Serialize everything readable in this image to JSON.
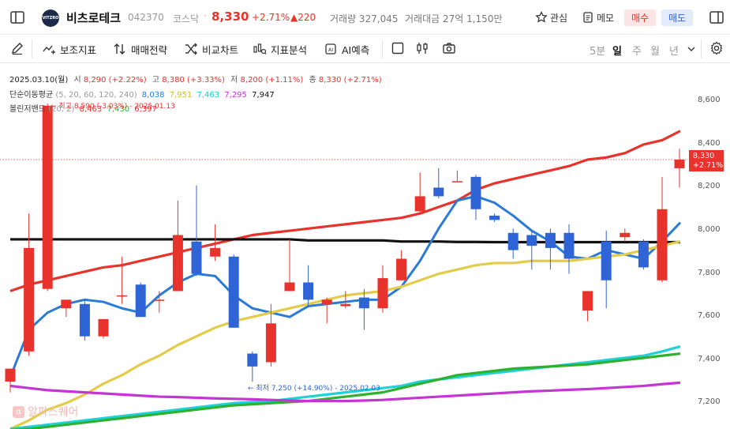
{
  "header": {
    "stock_name": "비츠로테크",
    "stock_code": "042370",
    "market": "코스닥",
    "separator": "·",
    "price": "8,330",
    "change_pct": "+2.71%",
    "change_abs": "▲220",
    "volume": "거래량 327,045",
    "amount": "거래대금 27억 1,150만",
    "logo_text": "VITZRO",
    "watch_label": "관심",
    "memo_label": "메모",
    "buy_label": "매수",
    "sell_label": "매도",
    "colors": {
      "up": "#e8322c",
      "down": "#2f64d6"
    }
  },
  "toolbar": {
    "items": [
      {
        "label": "보조지표",
        "icon": "indicator-icon"
      },
      {
        "label": "매매전략",
        "icon": "strategy-icon"
      },
      {
        "label": "비교차트",
        "icon": "compare-icon"
      },
      {
        "label": "지표분석",
        "icon": "analysis-icon"
      },
      {
        "label": "AI예측",
        "icon": "ai-icon"
      }
    ],
    "periods": [
      "5분",
      "일",
      "주",
      "월",
      "년"
    ],
    "active_period": "일"
  },
  "info": {
    "ohlc": {
      "date": "2025.03.10(월)",
      "open_label": "시",
      "open": "8,290 (+2.22%)",
      "high_label": "고",
      "high": "8,380 (+3.33%)",
      "low_label": "저",
      "low": "8,200 (+1.11%)",
      "close_label": "종",
      "close": "8,330 (+2.71%)"
    },
    "ma": {
      "label": "단순이동평균",
      "params": "(5, 20, 60, 120, 240)",
      "values": [
        "8,038",
        "7,951",
        "7,463",
        "7,295",
        "7,947"
      ],
      "colors": [
        "#2a7bd6",
        "#e3cc4a",
        "#1fd2d8",
        "#c435d4",
        "#111111"
      ]
    },
    "bb": {
      "label": "볼린저밴드",
      "params": "(20, 2)",
      "values": [
        "8,463",
        "7,430",
        "6,397"
      ],
      "colors": [
        "#e8322c",
        "#2fb02f",
        "#e8322c"
      ]
    }
  },
  "annotations": {
    "high": "← 최고 8,590 (-3.03%) - 2025.01.13",
    "low": "← 최저 7,250 (+14.90%) - 2025.02.03"
  },
  "current_price_tag": {
    "price": "8,330",
    "pct": "+2.71%"
  },
  "watermark": {
    "text": "알파스퀘어",
    "icon": "α"
  },
  "chart_data": {
    "type": "candlestick",
    "y_axis_ticks": [
      "8,600",
      "8,400",
      "8,200",
      "8,000",
      "7,800",
      "7,600",
      "7,400",
      "7,200"
    ],
    "y_range": [
      7080,
      8770
    ],
    "candles": [
      {
        "o": 7300,
        "h": 7360,
        "l": 7250,
        "c": 7360
      },
      {
        "o": 7440,
        "h": 8080,
        "l": 7420,
        "c": 7920
      },
      {
        "o": 7730,
        "h": 8590,
        "l": 7720,
        "c": 8580
      },
      {
        "o": 7640,
        "h": 7680,
        "l": 7600,
        "c": 7680
      },
      {
        "o": 7660,
        "h": 7680,
        "l": 7490,
        "c": 7510
      },
      {
        "o": 7510,
        "h": 7580,
        "l": 7500,
        "c": 7590
      },
      {
        "o": 7700,
        "h": 7880,
        "l": 7660,
        "c": 7700
      },
      {
        "o": 7750,
        "h": 7760,
        "l": 7600,
        "c": 7600
      },
      {
        "o": 7680,
        "h": 7720,
        "l": 7620,
        "c": 7680
      },
      {
        "o": 7720,
        "h": 8140,
        "l": 7720,
        "c": 7980
      },
      {
        "o": 7950,
        "h": 8210,
        "l": 7790,
        "c": 7800
      },
      {
        "o": 7880,
        "h": 8030,
        "l": 7860,
        "c": 7920
      },
      {
        "o": 7880,
        "h": 7890,
        "l": 7550,
        "c": 7550
      },
      {
        "o": 7430,
        "h": 7440,
        "l": 7300,
        "c": 7370
      },
      {
        "o": 7390,
        "h": 7660,
        "l": 7370,
        "c": 7570
      },
      {
        "o": 7720,
        "h": 7960,
        "l": 7720,
        "c": 7760
      },
      {
        "o": 7760,
        "h": 7840,
        "l": 7650,
        "c": 7680
      },
      {
        "o": 7660,
        "h": 7690,
        "l": 7570,
        "c": 7680
      },
      {
        "o": 7650,
        "h": 7720,
        "l": 7640,
        "c": 7660
      },
      {
        "o": 7690,
        "h": 7730,
        "l": 7540,
        "c": 7640
      },
      {
        "o": 7640,
        "h": 7840,
        "l": 7620,
        "c": 7780
      },
      {
        "o": 7770,
        "h": 7910,
        "l": 7770,
        "c": 7870
      },
      {
        "o": 8090,
        "h": 8270,
        "l": 8080,
        "c": 8160
      },
      {
        "o": 8200,
        "h": 8290,
        "l": 8150,
        "c": 8160
      },
      {
        "o": 8230,
        "h": 8280,
        "l": 8230,
        "c": 8230
      },
      {
        "o": 8250,
        "h": 8260,
        "l": 8050,
        "c": 8100
      },
      {
        "o": 8070,
        "h": 8080,
        "l": 8040,
        "c": 8050
      },
      {
        "o": 7990,
        "h": 8010,
        "l": 7870,
        "c": 7910
      },
      {
        "o": 7980,
        "h": 8000,
        "l": 7820,
        "c": 7930
      },
      {
        "o": 7990,
        "h": 8010,
        "l": 7820,
        "c": 7920
      },
      {
        "o": 7990,
        "h": 8030,
        "l": 7800,
        "c": 7870
      },
      {
        "o": 7630,
        "h": 7650,
        "l": 7580,
        "c": 7720
      },
      {
        "o": 7950,
        "h": 8000,
        "l": 7640,
        "c": 7770
      },
      {
        "o": 7970,
        "h": 8010,
        "l": 7950,
        "c": 7990
      },
      {
        "o": 7950,
        "h": 7960,
        "l": 7820,
        "c": 7830
      },
      {
        "o": 7770,
        "h": 8250,
        "l": 7760,
        "c": 8100
      },
      {
        "o": 8290,
        "h": 8380,
        "l": 8200,
        "c": 8330
      }
    ],
    "series": [
      {
        "name": "BB 상단",
        "color": "#e8322c",
        "values": [
          7720,
          7750,
          7770,
          7790,
          7810,
          7830,
          7840,
          7860,
          7880,
          7900,
          7920,
          7940,
          7960,
          7980,
          7990,
          8000,
          8010,
          8020,
          8030,
          8040,
          8050,
          8060,
          8080,
          8110,
          8140,
          8190,
          8220,
          8240,
          8260,
          8280,
          8300,
          8330,
          8340,
          8360,
          8400,
          8420,
          8463
        ]
      },
      {
        "name": "MA240",
        "color": "#111111",
        "values": [
          7960,
          7960,
          7960,
          7960,
          7960,
          7960,
          7960,
          7960,
          7960,
          7960,
          7960,
          7960,
          7960,
          7960,
          7960,
          7960,
          7955,
          7955,
          7955,
          7955,
          7955,
          7950,
          7950,
          7950,
          7948,
          7948,
          7947,
          7947,
          7947,
          7947,
          7947,
          7947,
          7947,
          7947,
          7947,
          7947,
          7947
        ]
      },
      {
        "name": "MA5",
        "color": "#2a7bd6",
        "values": [
          7320,
          7540,
          7620,
          7660,
          7680,
          7670,
          7640,
          7620,
          7700,
          7760,
          7800,
          7790,
          7700,
          7640,
          7620,
          7600,
          7650,
          7660,
          7670,
          7680,
          7680,
          7740,
          7860,
          8010,
          8140,
          8160,
          8130,
          8070,
          8000,
          7950,
          7880,
          7870,
          7910,
          7890,
          7870,
          7950,
          8038
        ]
      },
      {
        "name": "MA20",
        "color": "#e3cc4a",
        "values": [
          7080,
          7120,
          7170,
          7200,
          7240,
          7290,
          7330,
          7380,
          7420,
          7470,
          7510,
          7550,
          7580,
          7600,
          7620,
          7640,
          7660,
          7680,
          7700,
          7710,
          7720,
          7740,
          7770,
          7800,
          7820,
          7840,
          7850,
          7850,
          7860,
          7860,
          7860,
          7870,
          7880,
          7890,
          7910,
          7930,
          7951
        ]
      },
      {
        "name": "MA60",
        "color": "#1fd2d8",
        "values": [
          7080,
          7090,
          7100,
          7110,
          7120,
          7130,
          7140,
          7150,
          7160,
          7170,
          7180,
          7190,
          7200,
          7205,
          7210,
          7220,
          7230,
          7240,
          7250,
          7260,
          7270,
          7280,
          7300,
          7310,
          7320,
          7330,
          7340,
          7350,
          7360,
          7370,
          7380,
          7390,
          7400,
          7410,
          7420,
          7440,
          7463
        ]
      },
      {
        "name": "BB 중간",
        "color": "#2fb02f",
        "values": [
          7075,
          7080,
          7090,
          7100,
          7110,
          7120,
          7130,
          7140,
          7150,
          7160,
          7170,
          7180,
          7190,
          7195,
          7200,
          7205,
          7210,
          7220,
          7230,
          7240,
          7250,
          7270,
          7290,
          7310,
          7330,
          7340,
          7350,
          7360,
          7365,
          7370,
          7375,
          7380,
          7390,
          7400,
          7410,
          7420,
          7430
        ]
      },
      {
        "name": "MA120",
        "color": "#c435d4",
        "values": [
          7280,
          7270,
          7260,
          7255,
          7250,
          7245,
          7240,
          7235,
          7230,
          7228,
          7225,
          7222,
          7220,
          7218,
          7215,
          7212,
          7210,
          7210,
          7210,
          7212,
          7215,
          7220,
          7225,
          7230,
          7235,
          7240,
          7245,
          7250,
          7255,
          7258,
          7262,
          7265,
          7270,
          7275,
          7280,
          7288,
          7295
        ]
      }
    ]
  }
}
